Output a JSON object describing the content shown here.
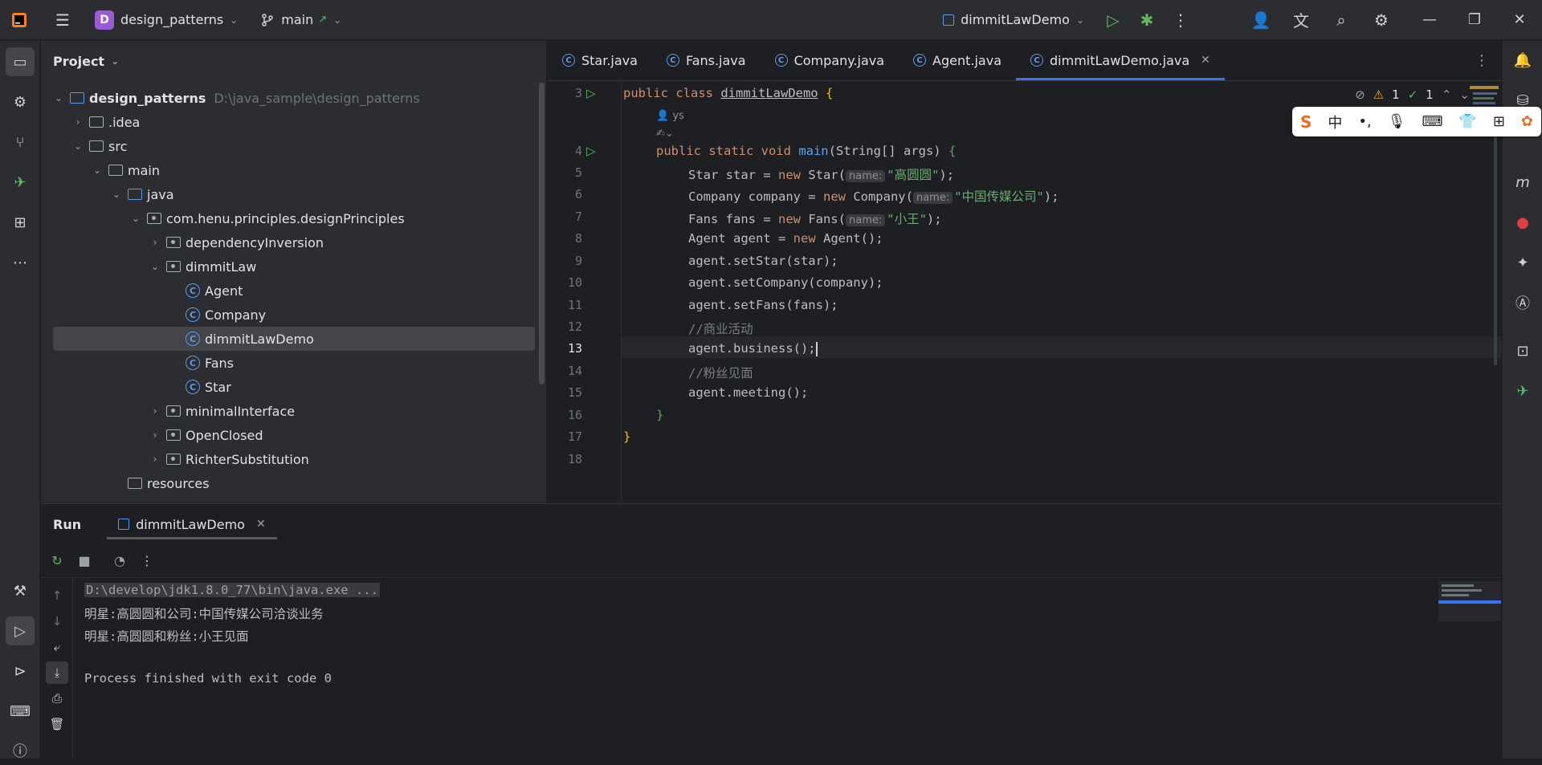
{
  "titlebar": {
    "project_badge": "D",
    "project_name": "design_patterns",
    "branch": "main",
    "branch_arrow": "↗",
    "run_config": "dimmitLawDemo"
  },
  "left_stripe": [
    "project-icon",
    "settings-icon",
    "git-icon",
    "jrebel-icon",
    "structure-icon",
    "more-icon",
    "build-icon",
    "run-icon",
    "services-icon",
    "terminal-icon",
    "problems-icon"
  ],
  "project": {
    "header": "Project",
    "tree": [
      {
        "label": "design_patterns",
        "hint": "D:\\java_sample\\design_patterns",
        "depth": 0,
        "arrow": "⌄",
        "icon": "module"
      },
      {
        "label": ".idea",
        "depth": 1,
        "arrow": "›",
        "icon": "folder"
      },
      {
        "label": "src",
        "depth": 1,
        "arrow": "⌄",
        "icon": "folder"
      },
      {
        "label": "main",
        "depth": 2,
        "arrow": "⌄",
        "icon": "folder"
      },
      {
        "label": "java",
        "depth": 3,
        "arrow": "⌄",
        "icon": "folder-blue"
      },
      {
        "label": "com.henu.principles.designPrinciples",
        "depth": 4,
        "arrow": "⌄",
        "icon": "package"
      },
      {
        "label": "dependencyInversion",
        "depth": 5,
        "arrow": "›",
        "icon": "package"
      },
      {
        "label": "dimmitLaw",
        "depth": 5,
        "arrow": "⌄",
        "icon": "package"
      },
      {
        "label": "Agent",
        "depth": 6,
        "arrow": "",
        "icon": "class"
      },
      {
        "label": "Company",
        "depth": 6,
        "arrow": "",
        "icon": "class"
      },
      {
        "label": "dimmitLawDemo",
        "depth": 6,
        "arrow": "",
        "icon": "class",
        "selected": true
      },
      {
        "label": "Fans",
        "depth": 6,
        "arrow": "",
        "icon": "class"
      },
      {
        "label": "Star",
        "depth": 6,
        "arrow": "",
        "icon": "class"
      },
      {
        "label": "minimalInterface",
        "depth": 5,
        "arrow": "›",
        "icon": "package"
      },
      {
        "label": "OpenClosed",
        "depth": 5,
        "arrow": "›",
        "icon": "package"
      },
      {
        "label": "RichterSubstitution",
        "depth": 5,
        "arrow": "›",
        "icon": "package"
      },
      {
        "label": "resources",
        "depth": 3,
        "arrow": "",
        "icon": "folder"
      }
    ]
  },
  "editor": {
    "tabs": [
      {
        "label": "Star.java",
        "active": false
      },
      {
        "label": "Fans.java",
        "active": false
      },
      {
        "label": "Company.java",
        "active": false
      },
      {
        "label": "Agent.java",
        "active": false
      },
      {
        "label": "dimmitLawDemo.java",
        "active": true
      }
    ],
    "indicators": {
      "warnings": "1",
      "ok": "1"
    },
    "author_hint": "ys",
    "line_numbers": [
      "3",
      "4",
      "5",
      "6",
      "7",
      "8",
      "9",
      "10",
      "11",
      "12",
      "13",
      "14",
      "15",
      "16",
      "17",
      "18"
    ],
    "current_line": "13",
    "code": {
      "l3_kw": "public class ",
      "l3_name": "dimmitLawDemo",
      "l3_brace": " {",
      "l4_kw": "public static void ",
      "l4_fn": "main",
      "l4_rest": "(String[] args) ",
      "l4_brace": "{",
      "l5_a": "Star star = ",
      "l5_kw": "new ",
      "l5_b": "Star(",
      "l5_hint": "name:",
      "l5_str": "\"高圆圆\"",
      "l5_c": ");",
      "l6_a": "Company company = ",
      "l6_kw": "new ",
      "l6_b": "Company(",
      "l6_hint": "name:",
      "l6_str": "\"中国传媒公司\"",
      "l6_c": ");",
      "l7_a": "Fans fans = ",
      "l7_kw": "new ",
      "l7_b": "Fans(",
      "l7_hint": "name:",
      "l7_str": "\"小王\"",
      "l7_c": ");",
      "l8_a": "Agent agent = ",
      "l8_kw": "new ",
      "l8_b": "Agent();",
      "l9": "agent.setStar(star);",
      "l10": "agent.setCompany(company);",
      "l11": "agent.setFans(fans);",
      "l12": "//商业活动",
      "l13": "agent.business();",
      "l14": "//粉丝见面",
      "l15": "agent.meeting();",
      "l16": "}",
      "l17": "}"
    }
  },
  "ime": {
    "logo": "S",
    "mode": "中",
    "punct": "•,",
    "items": [
      "mic-icon",
      "keyboard-icon",
      "skin-icon",
      "grid-icon",
      "tools-icon"
    ]
  },
  "run": {
    "title": "Run",
    "tab": "dimmitLawDemo",
    "console": [
      "D:\\develop\\jdk1.8.0_77\\bin\\java.exe ...",
      "明星:高圆圆和公司:中国传媒公司洽谈业务",
      "明星:高圆圆和粉丝:小王见面",
      "",
      "Process finished with exit code 0"
    ]
  }
}
